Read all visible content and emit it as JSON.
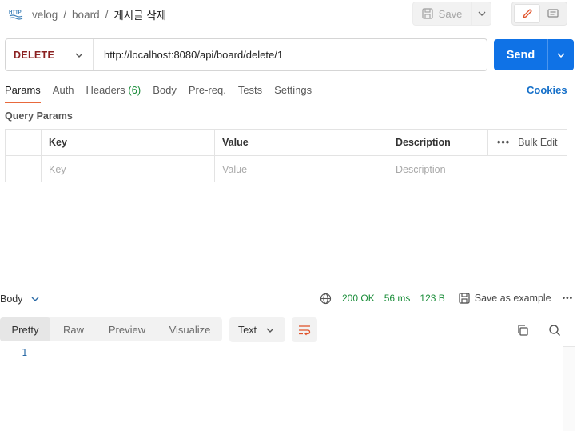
{
  "header": {
    "method_badge_icon": "http-icon",
    "breadcrumb": [
      "velog",
      "board"
    ],
    "current": "게시글 삭제",
    "save_label": "Save"
  },
  "request": {
    "method": "DELETE",
    "url": "http://localhost:8080/api/board/delete/1",
    "send_label": "Send"
  },
  "tabs": [
    {
      "label": "Params",
      "active": true
    },
    {
      "label": "Auth"
    },
    {
      "label": "Headers",
      "count": "(6)"
    },
    {
      "label": "Body"
    },
    {
      "label": "Pre-req."
    },
    {
      "label": "Tests"
    },
    {
      "label": "Settings"
    }
  ],
  "cookies_label": "Cookies",
  "query_params": {
    "title": "Query Params",
    "columns": [
      "Key",
      "Value",
      "Description"
    ],
    "bulk_edit": "Bulk Edit",
    "placeholders": [
      "Key",
      "Value",
      "Description"
    ]
  },
  "response": {
    "body_label": "Body",
    "status": "200 OK",
    "time": "56 ms",
    "size": "123 B",
    "save_example": "Save as example",
    "view_tabs": [
      "Pretty",
      "Raw",
      "Preview",
      "Visualize"
    ],
    "active_view": "Pretty",
    "format": "Text",
    "line_numbers": [
      "1"
    ]
  },
  "colors": {
    "accent": "#0f72e6",
    "method_delete": "#8b2121",
    "status_ok": "#1c8e3b",
    "tab_underline": "#e8693c"
  }
}
